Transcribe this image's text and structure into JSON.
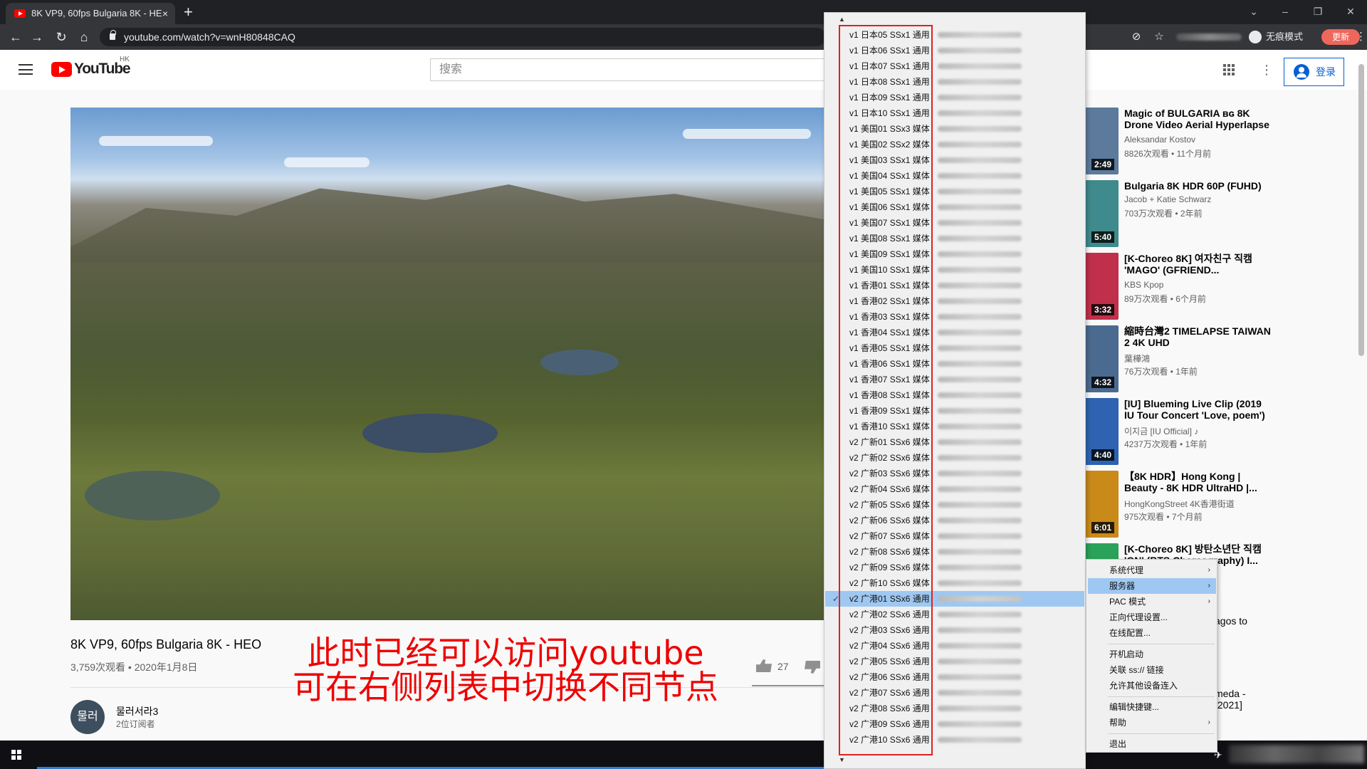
{
  "browser": {
    "tab_title": "8K VP9, 60fps Bulgaria 8K - HE",
    "tab_close": "×",
    "new_tab": "+",
    "url": "youtube.com/watch?v=wnH80848CAQ",
    "incognito_label": "无痕模式",
    "update_label": "更新",
    "window_controls": [
      "–",
      "❐",
      "✕"
    ]
  },
  "youtube": {
    "logo_text": "YouTube",
    "region": "HK",
    "search_placeholder": "搜索",
    "signin_label": "登录",
    "video": {
      "title": "8K VP9, 60fps Bulgaria 8K - HEO",
      "meta": "3,759次观看 • 2020年1月8日",
      "likes": "27",
      "channel_avatar_text": "물러",
      "channel_name": "물러서라3",
      "channel_subs": "2位订阅者"
    },
    "recommendations": [
      {
        "title": "Magic of BULGARIA ʙɢ 8K Drone Video Aerial Hyperlapse",
        "channel": "Aleksandar Kostov",
        "views": "8826次观看 • 11个月前",
        "duration": "2:49",
        "thumb_color": "#5b7a9c"
      },
      {
        "title": "Bulgaria 8K HDR 60P (FUHD)",
        "channel": "Jacob + Katie Schwarz",
        "views": "703万次观看 • 2年前",
        "duration": "5:40",
        "thumb_color": "#3f8a8c"
      },
      {
        "title": "[K-Choreo 8K] 여자친구 직캠 'MAGO' (GFRIEND...",
        "channel": "KBS Kpop",
        "views": "89万次观看 • 6个月前",
        "duration": "3:32",
        "thumb_color": "#c0304a"
      },
      {
        "title": "縮時台灣2 TIMELAPSE TAIWAN 2 4K UHD",
        "channel": "葉樺鴻",
        "views": "76万次观看 • 1年前",
        "duration": "4:32",
        "thumb_color": "#4b6a8f"
      },
      {
        "title": "[IU] Blueming Live Clip (2019 IU Tour Concert 'Love, poem')",
        "channel": "이지금 [IU Official] ♪",
        "views": "4237万次观看 • 1年前",
        "duration": "4:40",
        "thumb_color": "#2d63b0"
      },
      {
        "title": "【8K HDR】Hong Kong | Beauty - 8K HDR UltraHD |...",
        "channel": "HongKongStreet 4K香港街道",
        "views": "975次观看 • 7个月前",
        "duration": "6:01",
        "thumb_color": "#c98a1a"
      },
      {
        "title": "[K-Choreo 8K] 방탄소년단 직캠 'ON' (BTS Choreography) I...",
        "channel": "",
        "views": "",
        "duration": "",
        "thumb_color": "#2aa25a"
      }
    ],
    "rec_partial_1": "agos to",
    "rec_partial_2": "meda -\n[2021]"
  },
  "caption": {
    "line1": "此时已经可以访问youtube",
    "line2": "可在右侧列表中切换不同节点"
  },
  "server_list": {
    "scroll_up": "▲",
    "scroll_down": "▼",
    "check_mark": "✓",
    "items": [
      "v1 日本05 SSx1 通用",
      "v1 日本06 SSx1 通用",
      "v1 日本07 SSx1 通用",
      "v1 日本08 SSx1 通用",
      "v1 日本09 SSx1 通用",
      "v1 日本10 SSx1 通用",
      "v1 美国01 SSx3 媒体",
      "v1 美国02 SSx2 媒体",
      "v1 美国03 SSx1 媒体",
      "v1 美国04 SSx1 媒体",
      "v1 美国05 SSx1 媒体",
      "v1 美国06 SSx1 媒体",
      "v1 美国07 SSx1 媒体",
      "v1 美国08 SSx1 媒体",
      "v1 美国09 SSx1 媒体",
      "v1 美国10 SSx1 媒体",
      "v1 香港01 SSx1 媒体",
      "v1 香港02 SSx1 媒体",
      "v1 香港03 SSx1 媒体",
      "v1 香港04 SSx1 媒体",
      "v1 香港05 SSx1 媒体",
      "v1 香港06 SSx1 媒体",
      "v1 香港07 SSx1 媒体",
      "v1 香港08 SSx1 媒体",
      "v1 香港09 SSx1 媒体",
      "v1 香港10 SSx1 媒体",
      "v2 广新01 SSx6 媒体",
      "v2 广新02 SSx6 媒体",
      "v2 广新03 SSx6 媒体",
      "v2 广新04 SSx6 媒体",
      "v2 广新05 SSx6 媒体",
      "v2 广新06 SSx6 媒体",
      "v2 广新07 SSx6 媒体",
      "v2 广新08 SSx6 媒体",
      "v2 广新09 SSx6 媒体",
      "v2 广新10 SSx6 媒体",
      "v2 广港01 SSx6 通用",
      "v2 广港02 SSx6 通用",
      "v2 广港03 SSx6 通用",
      "v2 广港04 SSx6 通用",
      "v2 广港05 SSx6 通用",
      "v2 广港06 SSx6 通用",
      "v2 广港07 SSx6 通用",
      "v2 广港08 SSx6 通用",
      "v2 广港09 SSx6 通用",
      "v2 广港10 SSx6 通用"
    ],
    "selected_index": 36
  },
  "context_menu": {
    "items": [
      {
        "label": "系统代理",
        "submenu": "›"
      },
      {
        "label": "服务器",
        "submenu": "›"
      },
      {
        "label": "PAC 模式",
        "submenu": "›"
      },
      {
        "label": "正向代理设置..."
      },
      {
        "label": "在线配置..."
      },
      {
        "label": "开机启动"
      },
      {
        "label": "关联 ss:// 链接"
      },
      {
        "label": "允许其他设备连入"
      },
      {
        "label": "编辑快捷键..."
      },
      {
        "label": "帮助",
        "submenu": "›"
      },
      {
        "label": "退出"
      }
    ],
    "highlighted_index": 1
  }
}
